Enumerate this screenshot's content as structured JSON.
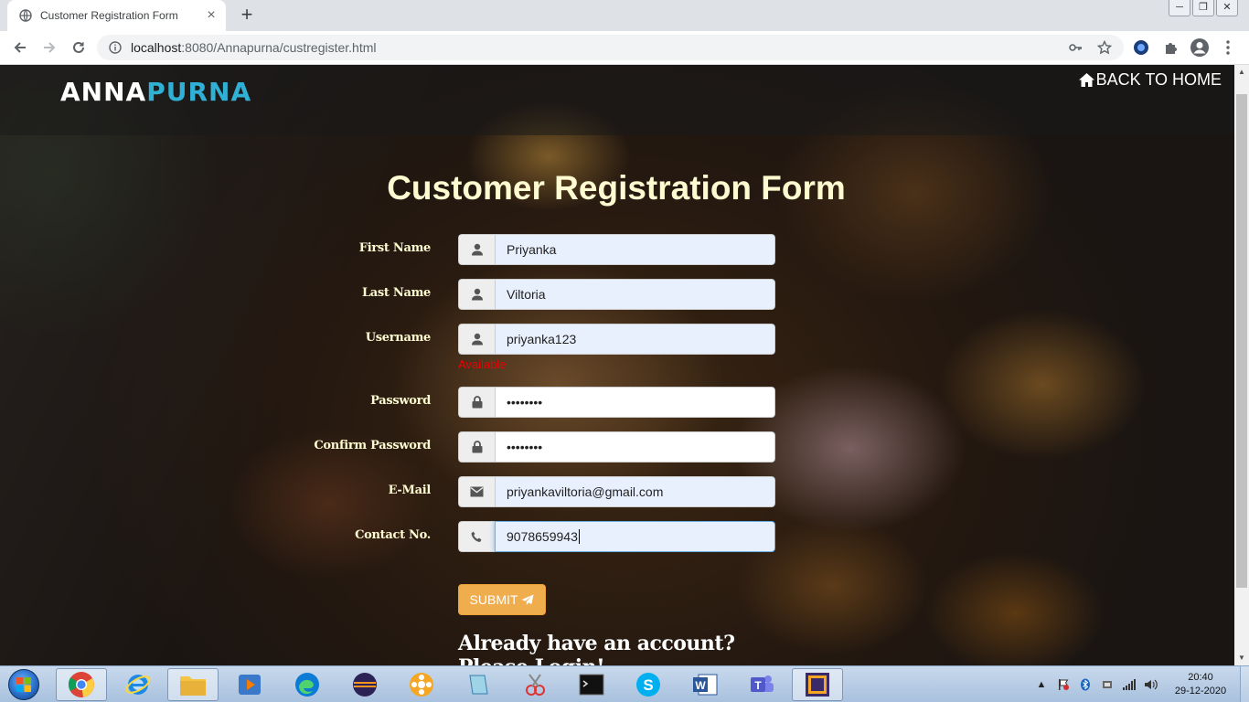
{
  "browser": {
    "tab_title": "Customer Registration Form",
    "tab_close": "×",
    "new_tab": "+",
    "url_host": "localhost",
    "url_path": ":8080/Annapurna/custregister.html",
    "window_controls": [
      "─",
      "❐",
      "✕"
    ]
  },
  "page": {
    "logo_part1": "ANNA",
    "logo_part2": "PURNA",
    "back_home": "BACK TO HOME",
    "form_title": "Customer Registration Form",
    "fields": [
      {
        "label": "First Name",
        "value": "Priyanka",
        "icon": "user-icon"
      },
      {
        "label": "Last Name",
        "value": "Viltoria",
        "icon": "user-icon"
      },
      {
        "label": "Username",
        "value": "priyanka123",
        "icon": "user-icon"
      },
      {
        "label": "Password",
        "value": "••••••••",
        "icon": "lock-icon"
      },
      {
        "label": "Confirm Password",
        "value": "••••••••",
        "icon": "lock-icon"
      },
      {
        "label": "E-Mail",
        "value": "priyankaviltoria@gmail.com",
        "icon": "envelope-icon"
      },
      {
        "label": "Contact No.",
        "value": "9078659943",
        "icon": "phone-icon"
      }
    ],
    "username_status": "Available",
    "submit_label": "SUBMIT",
    "login_prompt": "Already have an account?Please Login!"
  },
  "taskbar": {
    "time": "20:40",
    "date": "29-12-2020"
  },
  "colors": {
    "logo_accent": "#31b0d5",
    "title": "#fefbd0",
    "submit": "#f0ad4e",
    "status_ok": "#e00000"
  }
}
